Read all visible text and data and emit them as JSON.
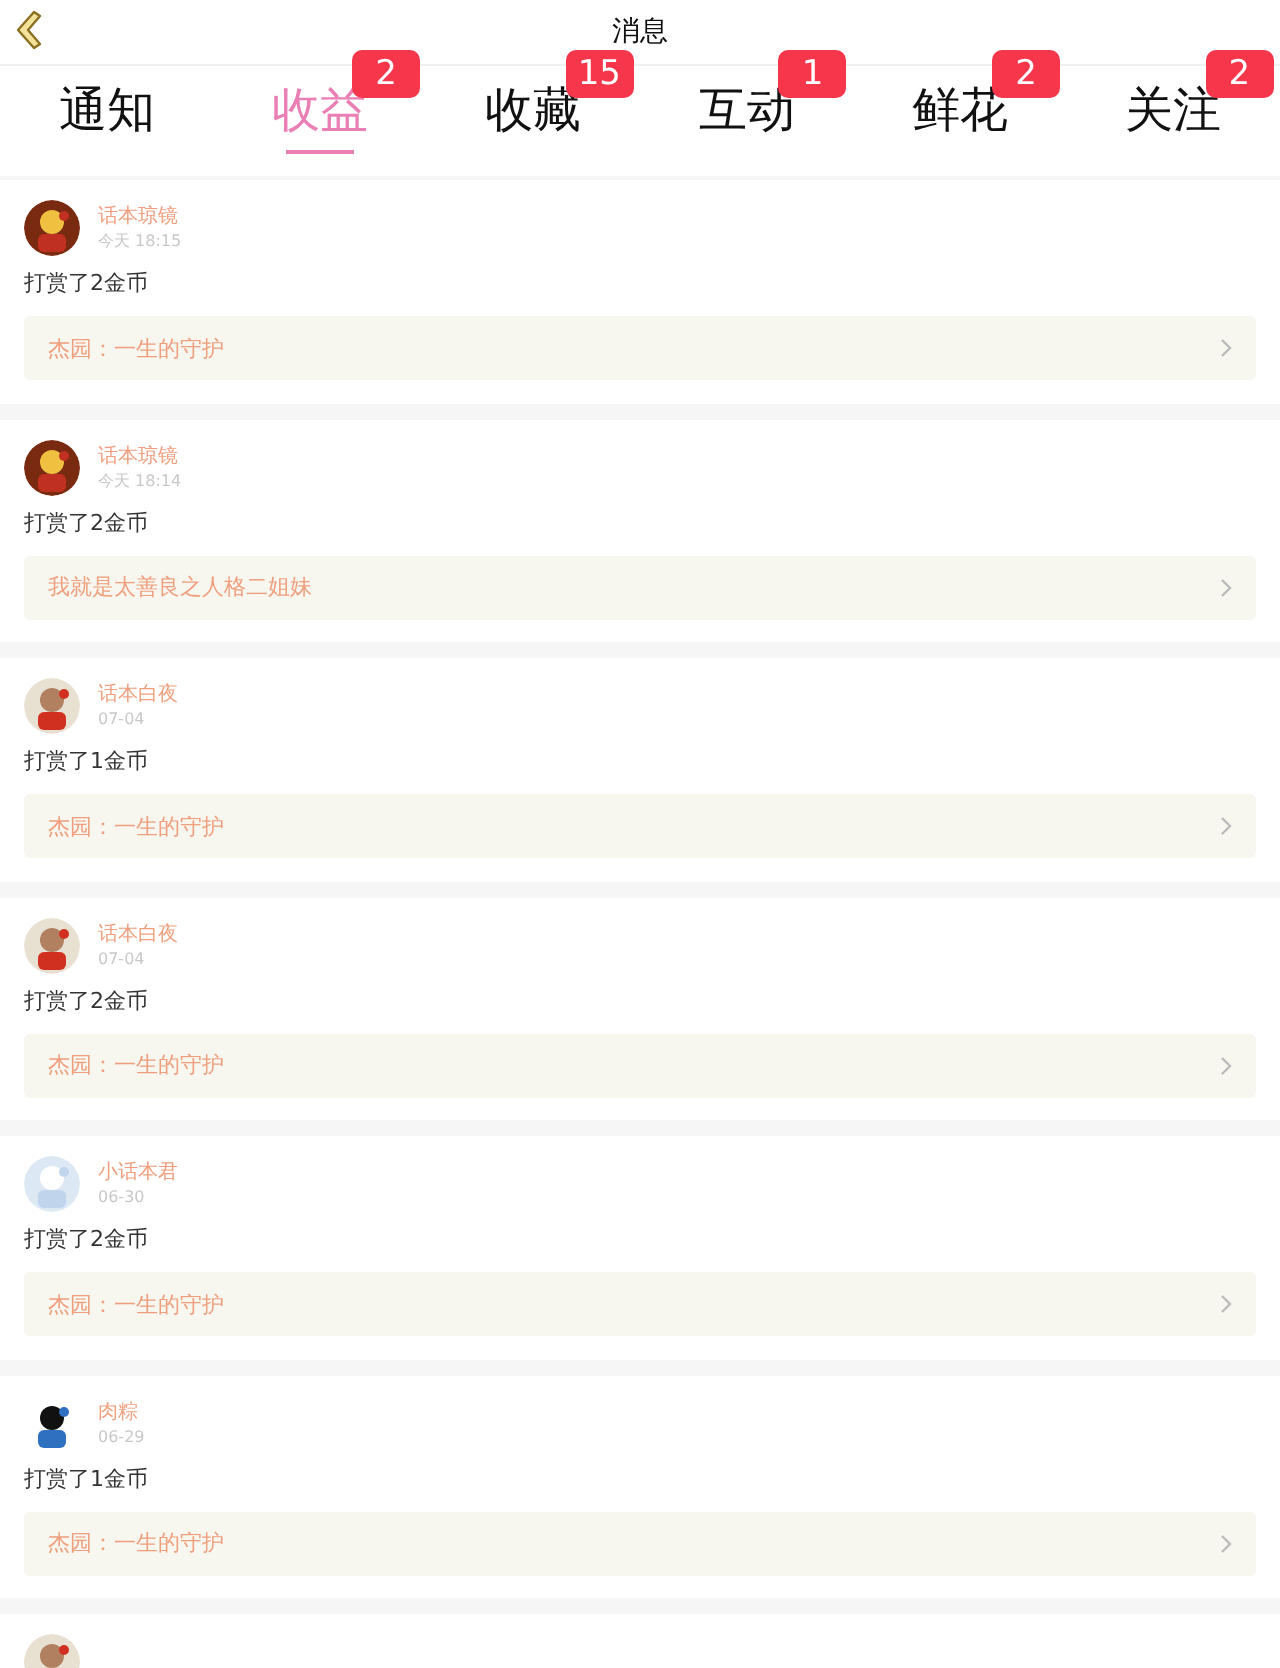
{
  "window": {
    "title": "消息"
  },
  "tabs": [
    {
      "label": "通知",
      "selected": false
    },
    {
      "label": "收益",
      "selected": true,
      "badge": "2"
    },
    {
      "label": "收藏",
      "selected": false,
      "badge": "15"
    },
    {
      "label": "互动",
      "selected": false,
      "badge": "1"
    },
    {
      "label": "鲜花",
      "selected": false,
      "badge": "2"
    },
    {
      "label": "关注",
      "selected": false,
      "badge": "2"
    }
  ],
  "messages": [
    {
      "user": "话本琼镜",
      "time": "今天 18:15",
      "text": "打赏了2金币",
      "story": "杰园：一生的守护"
    },
    {
      "user": "话本琼镜",
      "time": "今天 18:14",
      "text": "打赏了2金币",
      "story": "我就是太善良之人格二姐妹"
    },
    {
      "user": "话本白夜",
      "time": "07-04",
      "text": "打赏了1金币",
      "story": "杰园：一生的守护"
    },
    {
      "user": "话本白夜",
      "time": "07-04",
      "text": "打赏了2金币",
      "story": "杰园：一生的守护"
    },
    {
      "user": "小话本君",
      "time": "06-30",
      "text": "打赏了2金币",
      "story": "杰园：一生的守护"
    },
    {
      "user": "肉粽",
      "time": "06-29",
      "text": "打赏了1金币",
      "story": "杰园：一生的守护"
    }
  ],
  "more_below": true
}
